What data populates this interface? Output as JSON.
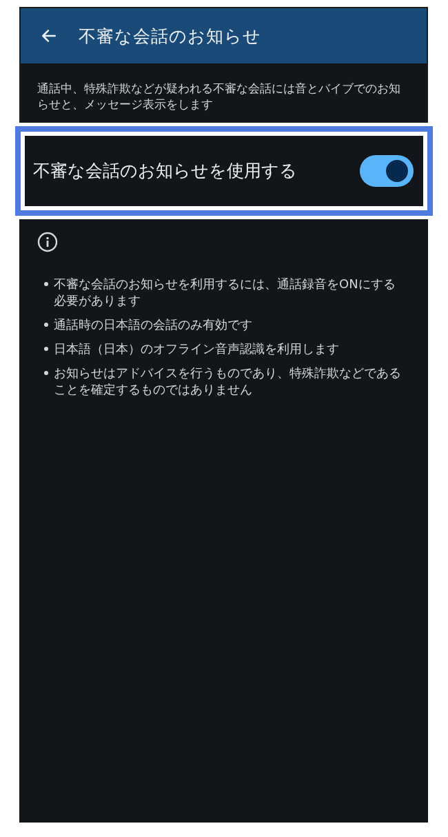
{
  "header": {
    "title": "不審な会話のお知らせ"
  },
  "description": "通話中、特殊詐欺などが疑われる不審な会話には音とバイブでのお知らせと、メッセージ表示をします",
  "setting": {
    "label": "不審な会話のお知らせを使用する",
    "on": true,
    "highlighted": true
  },
  "notes": [
    "不審な会話のお知らせを利用するには、通話録音をONにする必要があります",
    "通話時の日本語の会話のみ有効です",
    "日本語（日本）のオフライン音声認識を利用します",
    "お知らせはアドバイスを行うものであり、特殊詐欺などであることを確定するものではありません"
  ]
}
